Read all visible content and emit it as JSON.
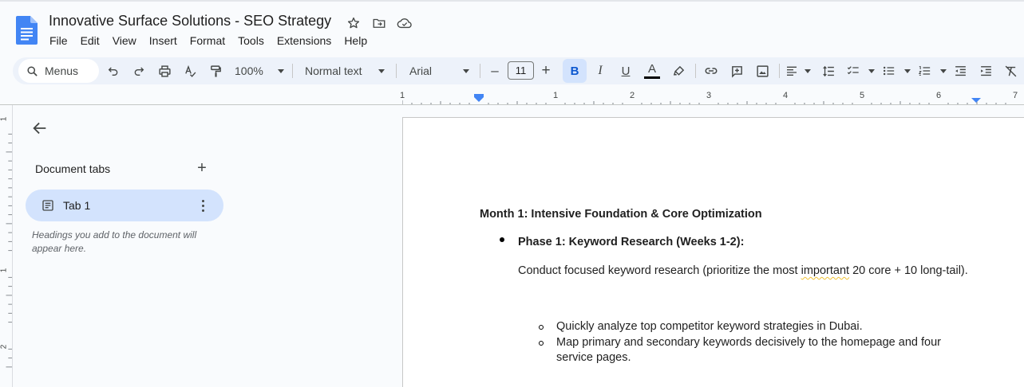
{
  "document": {
    "title": "Innovative Surface Solutions - SEO Strategy"
  },
  "menu": [
    "File",
    "Edit",
    "View",
    "Insert",
    "Format",
    "Tools",
    "Extensions",
    "Help"
  ],
  "toolbar": {
    "search_label": "Menus",
    "zoom": "100%",
    "style": "Normal text",
    "font": "Arial",
    "font_size": "11",
    "bold_label": "B",
    "italic_label": "I",
    "underline_label": "U",
    "text_color_label": "A",
    "minus_label": "–",
    "plus_label": "+"
  },
  "ruler": {
    "h_labels": [
      "1",
      "1",
      "2",
      "3",
      "4",
      "5",
      "6",
      "7"
    ],
    "v_labels": [
      "1",
      "1",
      "2"
    ]
  },
  "sidebar": {
    "heading": "Document tabs",
    "add_label": "+",
    "tab_label": "Tab 1",
    "hint": "Headings you add to the document will appear here."
  },
  "content": {
    "heading": "Month 1: Intensive Foundation & Core Optimization",
    "phase": "Phase 1: Keyword Research (Weeks 1-2):",
    "para_before": "Conduct focused keyword research (prioritize the most ",
    "para_flagged": "important",
    "para_after": " 20 core + 10 long-tail).",
    "sub_items": [
      "Quickly analyze top competitor keyword strategies in Dubai.",
      "Map primary and secondary keywords decisively to the homepage and four service pages."
    ]
  },
  "colors": {
    "accent": "#0b57d0",
    "toolbar_bg": "#edf2fa",
    "tab_selected": "#d3e3fd",
    "logo_blue": "#4285f4"
  }
}
